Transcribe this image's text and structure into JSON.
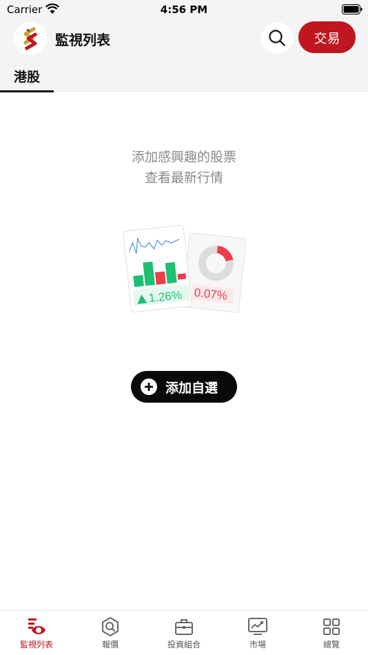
{
  "status_bar": {
    "carrier": "Carrier",
    "time": "4:56 PM"
  },
  "header": {
    "title": "監視列表",
    "trade_label": "交易"
  },
  "tabs": [
    {
      "label": "港股",
      "active": true
    }
  ],
  "empty_state": {
    "line1": "添加感興趣的股票",
    "line2": "查看最新行情",
    "illustration": {
      "gain_text": "1.26%",
      "loss_text": "0.07%"
    },
    "add_button_label": "添加自選"
  },
  "bottom_tabs": [
    {
      "label": "監視列表",
      "icon": "watchlist-icon",
      "active": true
    },
    {
      "label": "報價",
      "icon": "quote-icon",
      "active": false
    },
    {
      "label": "投資組合",
      "icon": "briefcase-icon",
      "active": false
    },
    {
      "label": "市場",
      "icon": "market-chart-icon",
      "active": false
    },
    {
      "label": "總覽",
      "icon": "grid-icon",
      "active": false
    }
  ],
  "colors": {
    "accent": "#c0161f",
    "gain": "#1dbf73",
    "loss": "#f03c4a",
    "header_bg": "#f4f4f4"
  }
}
